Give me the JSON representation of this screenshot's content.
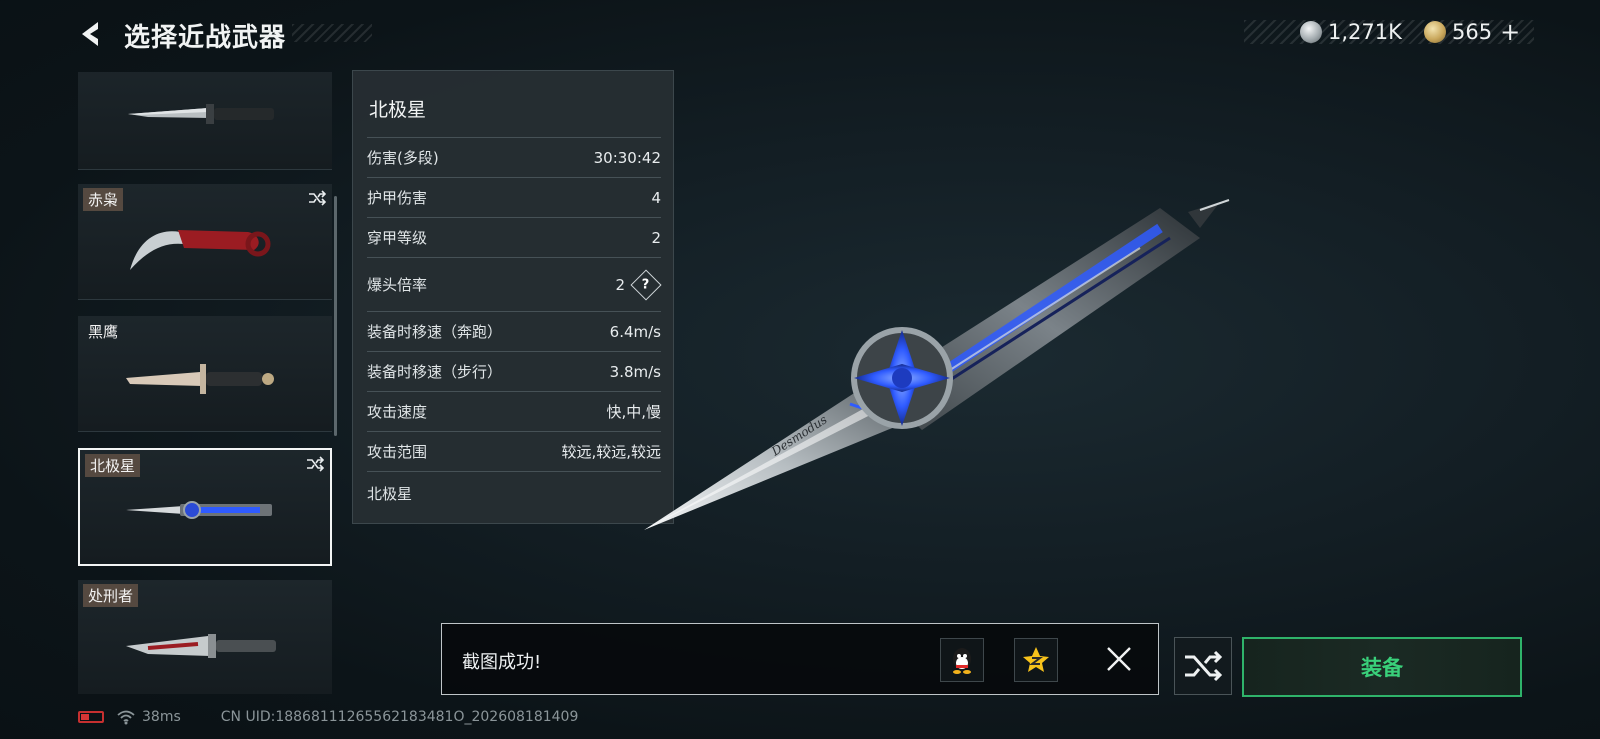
{
  "header": {
    "title": "选择近战武器",
    "currencies": [
      {
        "icon": "silver-coin-icon",
        "value": "1,271K"
      },
      {
        "icon": "gold-coin-icon",
        "value": "565",
        "add_symbol": "+"
      }
    ]
  },
  "weapon_list": {
    "items": [
      {
        "name": "",
        "has_shuffle": false,
        "selected": false
      },
      {
        "name": "赤枭",
        "has_shuffle": true,
        "selected": false
      },
      {
        "name": "黑鹰",
        "has_shuffle": false,
        "selected": false
      },
      {
        "name": "北极星",
        "has_shuffle": true,
        "selected": true
      },
      {
        "name": "处刑者",
        "has_shuffle": false,
        "selected": false
      }
    ]
  },
  "stats_panel": {
    "title": "北极星",
    "rows": [
      {
        "label": "伤害(多段)",
        "value": "30:30:42"
      },
      {
        "label": "护甲伤害",
        "value": "4"
      },
      {
        "label": "穿甲等级",
        "value": "2"
      },
      {
        "label": "爆头倍率",
        "value": "2",
        "help": "?"
      },
      {
        "label": "装备时移速（奔跑）",
        "value": "6.4m/s"
      },
      {
        "label": "装备时移速（步行）",
        "value": "3.8m/s"
      },
      {
        "label": "攻击速度",
        "value": "快,中,慢"
      },
      {
        "label": "攻击范围",
        "value": "较远,较远,较远"
      }
    ],
    "footer": "北极星"
  },
  "weapon_engraving": "Desmodus",
  "toast": {
    "message": "截图成功!",
    "share_buttons": [
      "qq-icon",
      "qzone-icon"
    ]
  },
  "actions": {
    "equip_label": "装备"
  },
  "status_bar": {
    "ping": "38ms",
    "uid": "CN UID:18868111265562183481O_202608181409"
  },
  "colors": {
    "equip_accent": "#39d07a",
    "battery_low": "#d63535",
    "blade_blue": "#2f5bff"
  }
}
